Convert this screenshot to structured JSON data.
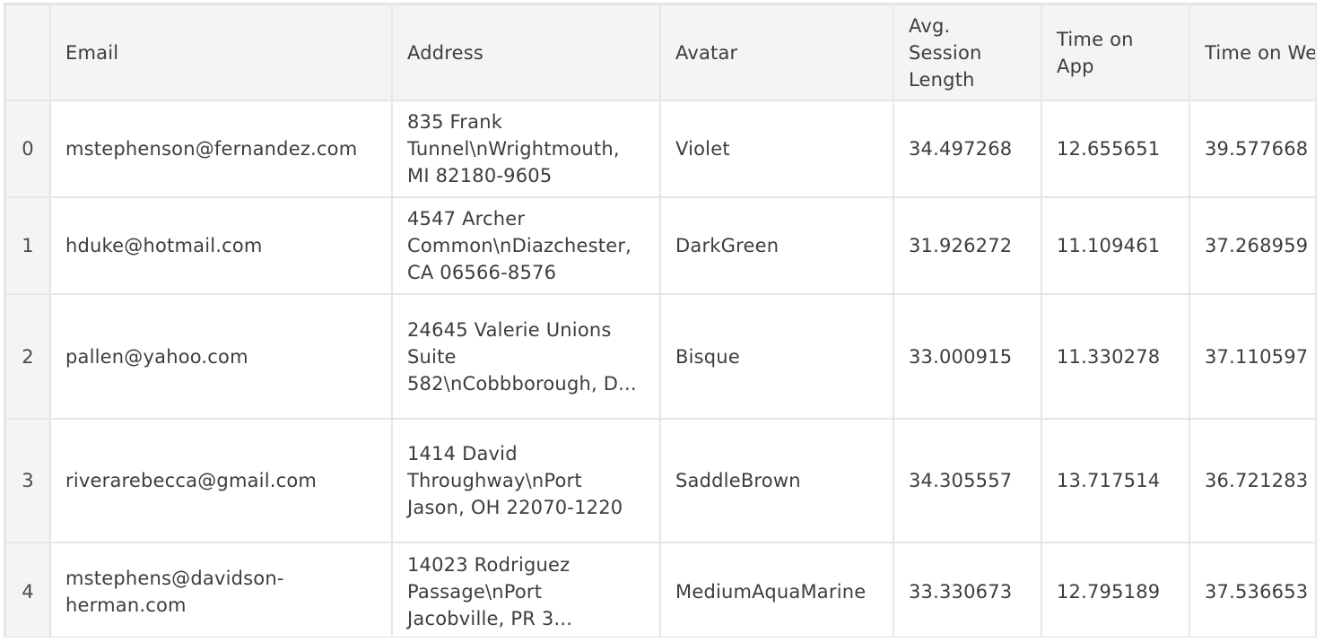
{
  "table": {
    "columns": [
      {
        "key": "index",
        "label": ""
      },
      {
        "key": "email",
        "label": "Email"
      },
      {
        "key": "address",
        "label": "Address"
      },
      {
        "key": "avatar",
        "label": "Avatar"
      },
      {
        "key": "avg_session_length",
        "label": "Avg. Session Length"
      },
      {
        "key": "time_on_app",
        "label": "Time on App"
      },
      {
        "key": "time_on_website",
        "label": "Time on Website"
      }
    ],
    "rows": [
      {
        "index": "0",
        "email": "mstephenson@fernandez.com",
        "address": "835 Frank Tunnel\\nWrightmouth, MI 82180-9605",
        "avatar": "Violet",
        "avg_session_length": "34.497268",
        "time_on_app": "12.655651",
        "time_on_website": "39.577668"
      },
      {
        "index": "1",
        "email": "hduke@hotmail.com",
        "address": "4547 Archer Common\\nDiazchester, CA 06566-8576",
        "avatar": "DarkGreen",
        "avg_session_length": "31.926272",
        "time_on_app": "11.109461",
        "time_on_website": "37.268959"
      },
      {
        "index": "2",
        "email": "pallen@yahoo.com",
        "address": "24645 Valerie Unions Suite 582\\nCobbborough, D...",
        "avatar": "Bisque",
        "avg_session_length": "33.000915",
        "time_on_app": "11.330278",
        "time_on_website": "37.110597"
      },
      {
        "index": "3",
        "email": "riverarebecca@gmail.com",
        "address": "1414 David Throughway\\nPort Jason, OH 22070-1220",
        "avatar": "SaddleBrown",
        "avg_session_length": "34.305557",
        "time_on_app": "13.717514",
        "time_on_website": "36.721283"
      },
      {
        "index": "4",
        "email": "mstephens@davidson-herman.com",
        "address": "14023 Rodriguez Passage\\nPort Jacobville, PR 3...",
        "avatar": "MediumAquaMarine",
        "avg_session_length": "33.330673",
        "time_on_app": "12.795189",
        "time_on_website": "37.536653"
      }
    ]
  }
}
